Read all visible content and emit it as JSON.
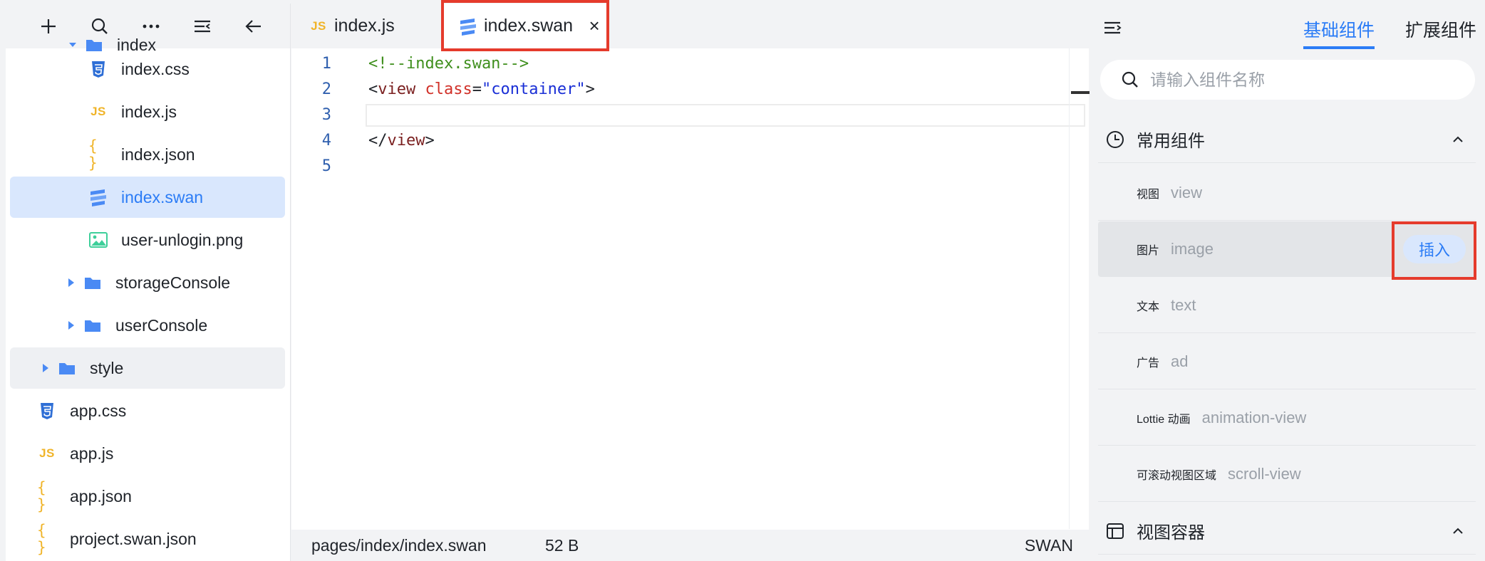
{
  "sidebar": {
    "toolbar": {
      "add": "plus-icon",
      "search": "search-icon",
      "more": "more-icon",
      "collapse": "collapse-icon",
      "back": "arrow-left-icon"
    },
    "items": [
      {
        "label": "index",
        "icon": "folder-icon",
        "partial": true
      },
      {
        "label": "index.css",
        "icon": "css-file-icon"
      },
      {
        "label": "index.js",
        "icon": "js-file-icon",
        "glyph": "JS"
      },
      {
        "label": "index.json",
        "icon": "json-file-icon",
        "glyph": "{ }"
      },
      {
        "label": "index.swan",
        "icon": "swan-file-icon",
        "selected": true
      },
      {
        "label": "user-unlogin.png",
        "icon": "image-file-icon"
      },
      {
        "label": "storageConsole",
        "icon": "folder-icon",
        "expandable": true
      },
      {
        "label": "userConsole",
        "icon": "folder-icon",
        "expandable": true
      },
      {
        "label": "style",
        "icon": "folder-icon",
        "expandable": true,
        "hover": true
      },
      {
        "label": "app.css",
        "icon": "css-file-icon"
      },
      {
        "label": "app.js",
        "icon": "js-file-icon",
        "glyph": "JS"
      },
      {
        "label": "app.json",
        "icon": "json-file-icon",
        "glyph": "{ }"
      },
      {
        "label": "project.swan.json",
        "icon": "json-file-icon",
        "glyph": "{ }",
        "partial": true
      }
    ]
  },
  "editor": {
    "tabs": [
      {
        "label": "index.js",
        "glyph": "JS",
        "active": false
      },
      {
        "label": "index.swan",
        "active": true,
        "close": "×"
      }
    ],
    "lines": [
      {
        "n": "1"
      },
      {
        "n": "2"
      },
      {
        "n": "3"
      },
      {
        "n": "4"
      },
      {
        "n": "5"
      }
    ],
    "code": {
      "l1": "<!--index.swan-->",
      "l2_open": "<",
      "l2_tag": "view",
      "l2_attr": "class",
      "l2_eq": "=",
      "l2_str": "\"container\"",
      "l2_close": ">",
      "l4_open": "</",
      "l4_tag": "view",
      "l4_close": ">"
    },
    "status": {
      "path": "pages/index/index.swan",
      "size": "52 B",
      "lang": "SWAN"
    }
  },
  "panel": {
    "tabs": [
      "基础组件",
      "扩展组件"
    ],
    "search_placeholder": "请输入组件名称",
    "section_common": "常用组件",
    "section_view": "视图容器",
    "components": [
      {
        "name": "视图",
        "tag": "view"
      },
      {
        "name": "图片",
        "tag": "image",
        "hover": true,
        "action": "插入"
      },
      {
        "name": "文本",
        "tag": "text"
      },
      {
        "name": "广告",
        "tag": "ad"
      },
      {
        "name": "Lottie 动画",
        "tag": "animation-view"
      },
      {
        "name": "可滚动视图区域",
        "tag": "scroll-view"
      }
    ]
  },
  "colors": {
    "accent": "#2b7cf6",
    "highlight": "#e53b2c",
    "selected_bg": "#d9e7fd",
    "icon_yellow": "#f0b429",
    "folder_blue": "#4a8af4"
  }
}
